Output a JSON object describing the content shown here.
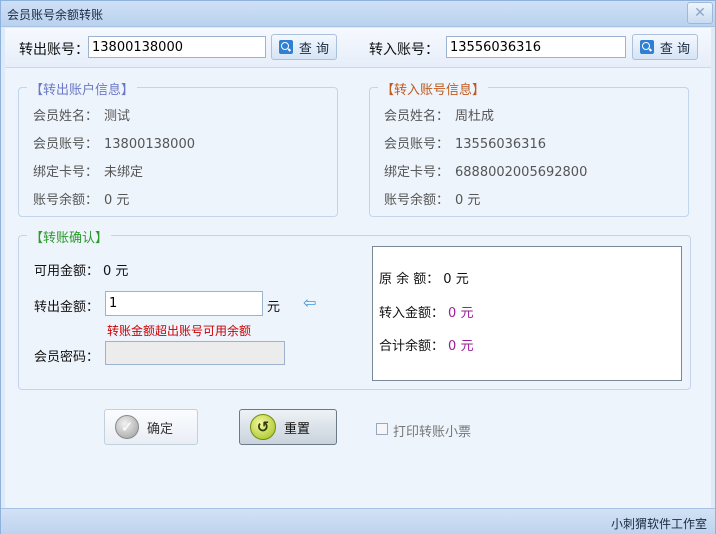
{
  "window": {
    "title": "会员账号余额转账",
    "close_glyph": "✕"
  },
  "search": {
    "out_label": "转出账号：",
    "out_value": "13800138000",
    "in_label": "转入账号：",
    "in_value": "13556036316",
    "query_label": "查 询"
  },
  "out_info": {
    "title": "【转出账户信息】",
    "name_label": "会员姓名：",
    "name": "测试",
    "account_label": "会员账号：",
    "account": "13800138000",
    "card_label": "绑定卡号：",
    "card": "未绑定",
    "balance_label": "账号余额：",
    "balance": "0 元"
  },
  "in_info": {
    "title": "【转入账号信息】",
    "name_label": "会员姓名：",
    "name": "周杜成",
    "account_label": "会员账号：",
    "account": "13556036316",
    "card_label": "绑定卡号：",
    "card": "6888002005692800",
    "balance_label": "账号余额：",
    "balance": "0 元"
  },
  "confirm": {
    "title": "【转账确认】",
    "available_label": "可用金额：",
    "available_value": "0 元",
    "amount_label": "转出金额：",
    "amount_value": "1",
    "amount_unit": "元",
    "arrow_glyph": "⇦",
    "error_text": "转账金额超出账号可用余额",
    "password_label": "会员密码："
  },
  "summary": {
    "orig_label": "原 余 额：",
    "orig_value": "0",
    "orig_unit": "元",
    "in_label": "转入金额：",
    "in_value": "0",
    "in_unit": "元",
    "total_label": "合计余额：",
    "total_value": "0",
    "total_unit": "元"
  },
  "buttons": {
    "ok_label": "确定",
    "reset_label": "重置",
    "ok_glyph": "✓",
    "reset_glyph": "↺"
  },
  "print_receipt": {
    "label": "打印转账小票",
    "checked": false
  },
  "status": {
    "text": "小刺猬软件工作室"
  },
  "colors": {
    "out_title": "#6b78c8",
    "in_title": "#c05a1e",
    "confirm_title": "#2a9a2a",
    "error": "#cc0000",
    "summary_value": "#9b1e9b",
    "arrow": "#3a97e0"
  }
}
